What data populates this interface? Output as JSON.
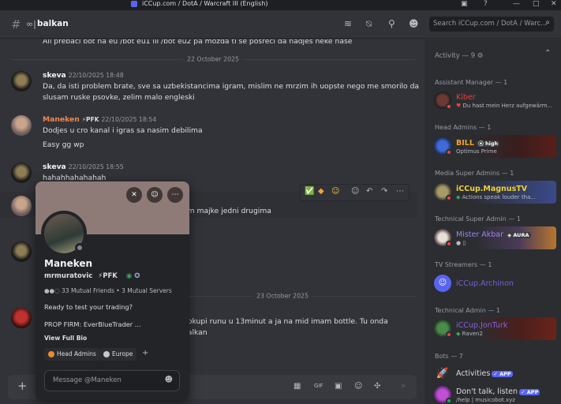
{
  "titlebar": {
    "title": "iCCup.com / DotA / Warcraft III (English)"
  },
  "header": {
    "channel": "balkan",
    "search_placeholder": "Search iCCup.com / DotA / Warc..."
  },
  "messages": {
    "top_line": "Ali prebaci bot na eu /bot eu1 ili /bot eu2 pa mozda ti se posreci da nadjes neke nase",
    "date1": "22 October 2025",
    "m1": {
      "author": "skeva",
      "time": "22/10/2025 18:48",
      "line1": "Da, da isti problem brate, sve sa uzbekistancima igram, mislim ne mrzim ih uopste nego me smorilo da",
      "line2": "slusam ruske psovke, zelim malo engleski"
    },
    "m2": {
      "author": "Maneken",
      "tag": "PFK",
      "time": "22/10/2025 18:54",
      "line1": "Dodjes u cro kanal i igras sa nasim debilima",
      "line2": "Easy gg wp"
    },
    "m3": {
      "author": "skeva",
      "time": "22/10/2025 18:55",
      "line1": "hahahhahahahah"
    },
    "m4": {
      "fragment": "am majke jedni drugima"
    },
    "date2": "23 October 2025",
    "m5": {
      "fragment1": "pokupi runu u 13minut a ja na mid imam bottle. Tu onda",
      "fragment2": "balkan"
    }
  },
  "composer": {
    "placeholder": "Message #balkan"
  },
  "members": {
    "activity": "Activity — 9",
    "sections": [
      {
        "title": "Assistant Manager — 1",
        "name": "Kiber",
        "sub": "Du hast mein Herz aufgewärm...",
        "color": "#e0443a"
      },
      {
        "title": "Head Admins — 1",
        "name": "BILL",
        "badge": "high",
        "sub": "Optimus Prime",
        "color": "#f0a232"
      },
      {
        "title": "Media Super Admins — 1",
        "name": "iCCup.MagnusTV",
        "sub": "Actions speak louder tha...",
        "color": "#f0d232"
      },
      {
        "title": "Technical Super Admin — 1",
        "name": "Mister Akbar",
        "badge": "AURA",
        "sub": "",
        "color": "#9b84ec"
      },
      {
        "title": "TV Streamers — 1",
        "name": "iCCup.Archinon",
        "sub": "",
        "color": "#7b5fd9"
      },
      {
        "title": "Technical Admin — 1",
        "name": "iCCup.JonTurk",
        "sub": "Raven2",
        "color": "#8d5fd3"
      },
      {
        "title": "Bots — 7",
        "name": "Activities",
        "badge": "APP",
        "sub": "",
        "color": "#dbdee1"
      },
      {
        "title": "",
        "name": "Don't talk, listen",
        "badge": "APP",
        "sub": "/help | musicobot.xyz",
        "color": "#dbdee1"
      }
    ]
  },
  "profile": {
    "name": "Maneken",
    "username": "mrmuratovic",
    "tag": "PFK",
    "mutual": "33 Mutual Friends • 3 Mutual Servers",
    "bio1": "Ready to test your trading?",
    "bio2": "PROP FIRM:  EverBlueTrader  ...",
    "view_bio": "View Full Bio",
    "roles": [
      "Head Admins",
      "Europe"
    ],
    "message_placeholder": "Message @Maneken"
  }
}
